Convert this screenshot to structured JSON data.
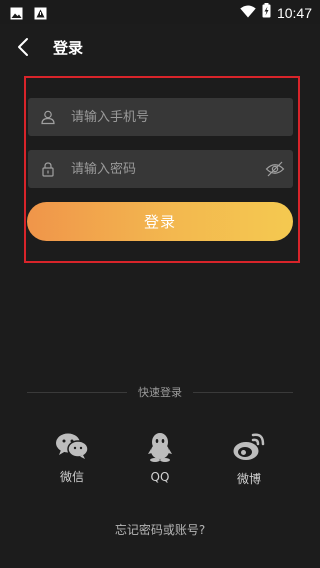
{
  "status_bar": {
    "time": "10:47",
    "left_icons": [
      "image-icon",
      "alert-icon"
    ],
    "right_icons": [
      "wifi-icon",
      "battery-icon"
    ]
  },
  "header": {
    "title": "登录",
    "back_icon": "back-arrow-icon"
  },
  "form": {
    "phone_placeholder": "请输入手机号",
    "phone_value": "",
    "password_placeholder": "请输入密码",
    "password_value": "",
    "login_label": "登录",
    "highlight_color": "#d8242a",
    "button_gradient": [
      "#f0954a",
      "#f4c950"
    ]
  },
  "quick_login": {
    "label": "快速登录",
    "options": [
      {
        "label": "微信",
        "icon": "wechat-icon"
      },
      {
        "label": "QQ",
        "icon": "qq-icon"
      },
      {
        "label": "微博",
        "icon": "weibo-icon"
      }
    ]
  },
  "forgot_link": "忘记密码或账号?"
}
